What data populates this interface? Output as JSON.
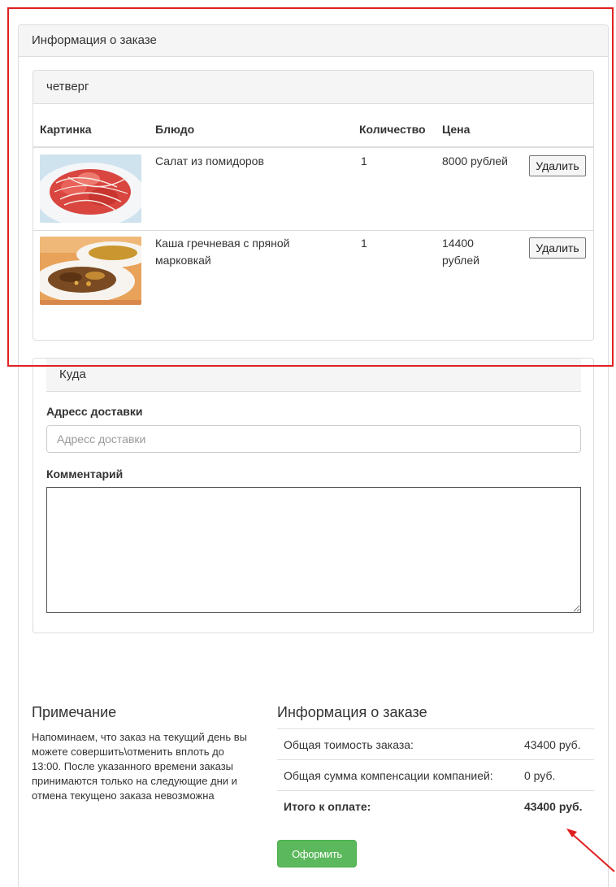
{
  "panel": {
    "title": "Информация о заказе"
  },
  "day": {
    "title": "четверг",
    "columns": {
      "picture": "Картинка",
      "dish": "Блюдо",
      "qty": "Количество",
      "price": "Цена"
    },
    "rows": [
      {
        "dish": "Салат из помидоров",
        "qty": "1",
        "price": "8000 рублей",
        "delete": "Удалить"
      },
      {
        "dish": "Каша гречневая с пряной марковкай",
        "qty": "1",
        "price": "14400 рублей",
        "delete": "Удалить"
      }
    ]
  },
  "delivery": {
    "title": "Куда",
    "address_label": "Адресс доставки",
    "address_placeholder": "Адресс доставки",
    "address_value": "",
    "comment_label": "Комментарий",
    "comment_value": ""
  },
  "note": {
    "title": "Примечание",
    "text": "Напоминаем, что заказ на текущий день вы можете совершить\\отменить вплоть до 13:00. После указанного времени заказы принимаются только на следующие дни и отмена текущено заказа невозможна"
  },
  "summary": {
    "title": "Информация о заказе",
    "total_cost_label": "Общая тоимость заказа:",
    "total_cost_value": "43400 руб.",
    "compensation_label": "Общая сумма компенсации компанией:",
    "compensation_value": "0 руб.",
    "to_pay_label": "Итого к оплате:",
    "to_pay_value": "43400 руб."
  },
  "submit_label": "Оформить",
  "colors": {
    "accent_green": "#5cb85c",
    "annotation_red": "#e02020",
    "panel_heading": "#f5f5f5",
    "border": "#dddddd"
  }
}
